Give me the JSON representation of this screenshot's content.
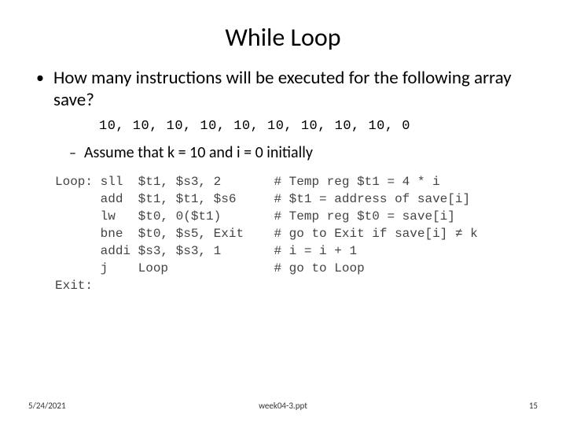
{
  "title": "While Loop",
  "bullet": "How many instructions will be executed for the following array save?",
  "array": "10, 10, 10, 10, 10, 10, 10, 10, 10, 0",
  "sub_bullet": "Assume that k = 10 and i = 0 initially",
  "code": "Loop: sll  $t1, $s3, 2       # Temp reg $t1 = 4 * i\n      add  $t1, $t1, $s6     # $t1 = address of save[i]\n      lw   $t0, 0($t1)       # Temp reg $t0 = save[i]\n      bne  $t0, $s5, Exit    # go to Exit if save[i] ≠ k\n      addi $s3, $s3, 1       # i = i + 1\n      j    Loop              # go to Loop\nExit:",
  "footer": {
    "date": "5/24/2021",
    "file": "week04-3.ppt",
    "page": "15"
  }
}
